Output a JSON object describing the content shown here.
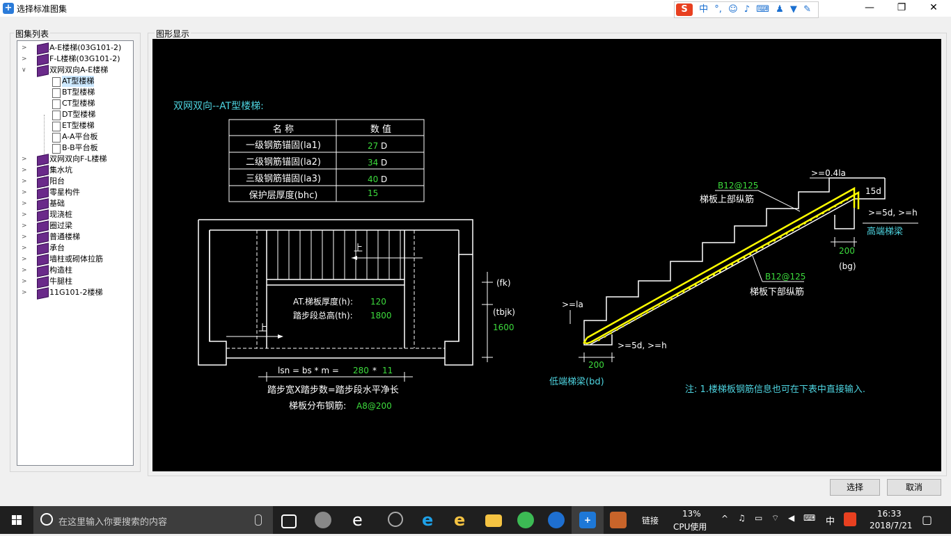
{
  "window": {
    "title": "选择标准图集",
    "minimize": "—",
    "maximize": "❐",
    "close": "✕"
  },
  "ime_toolbar": {
    "logo": "S",
    "mode": "中",
    "punct": "°,",
    "icons": [
      "smiley-icon",
      "mic-icon",
      "keyboard-icon",
      "user-icon",
      "shirt-icon",
      "wrench-icon"
    ]
  },
  "left_panel": {
    "title": "图集列表",
    "tree": [
      {
        "label": "A-E楼梯(03G101-2)",
        "level": 0,
        "expanded": false
      },
      {
        "label": "F-L楼梯(03G101-2)",
        "level": 0,
        "expanded": false
      },
      {
        "label": "双网双向A-E楼梯",
        "level": 0,
        "expanded": true
      },
      {
        "label": "AT型楼梯",
        "level": 1,
        "selected": true
      },
      {
        "label": "BT型楼梯",
        "level": 1
      },
      {
        "label": "CT型楼梯",
        "level": 1
      },
      {
        "label": "DT型楼梯",
        "level": 1
      },
      {
        "label": "ET型楼梯",
        "level": 1
      },
      {
        "label": "A-A平台板",
        "level": 1
      },
      {
        "label": "B-B平台板",
        "level": 1
      },
      {
        "label": "双网双向F-L楼梯",
        "level": 0
      },
      {
        "label": "集水坑",
        "level": 0
      },
      {
        "label": "阳台",
        "level": 0
      },
      {
        "label": "零星构件",
        "level": 0
      },
      {
        "label": "基础",
        "level": 0
      },
      {
        "label": "现浇桩",
        "level": 0
      },
      {
        "label": "圈过梁",
        "level": 0
      },
      {
        "label": "普通楼梯",
        "level": 0
      },
      {
        "label": "承台",
        "level": 0
      },
      {
        "label": "墙柱或砌体拉筋",
        "level": 0
      },
      {
        "label": "构造柱",
        "level": 0
      },
      {
        "label": "牛腿柱",
        "level": 0
      },
      {
        "label": "11G101-2楼梯",
        "level": 0
      }
    ]
  },
  "right_panel": {
    "title": "图形显示"
  },
  "drawing": {
    "heading": "双网双向--AT型楼梯:",
    "table": {
      "headers": [
        "名 称",
        "数 值"
      ],
      "rows": [
        {
          "name": "一级钢筋锚固(la1)",
          "value": "27",
          "unit": "D"
        },
        {
          "name": "二级钢筋锚固(la2)",
          "value": "34",
          "unit": "D"
        },
        {
          "name": "三级钢筋锚固(la3)",
          "value": "40",
          "unit": "D"
        },
        {
          "name": "保护层厚度(bhc)",
          "value": "15",
          "unit": ""
        }
      ]
    },
    "plan": {
      "up1": "上",
      "up2": "上",
      "thickness_label": "AT.梯板厚度(h):",
      "thickness_value": "120",
      "height_label": "踏步段总高(th):",
      "height_value": "1800",
      "fk": "(fk)",
      "tbjk": "(tbjk)",
      "tbjk_value": "1600",
      "lsn_label": "lsn = bs * m =",
      "bs_value": "280",
      "times": "*",
      "m_value": "11",
      "formula_text": "踏步宽X踏步数=踏步段水平净长",
      "dist_label": "梯板分布钢筋:",
      "dist_value": "A8@200"
    },
    "section": {
      "top_bar_code": "B12@125",
      "top_bar_label": "梯板上部纵筋",
      "bottom_bar_code": "B12@125",
      "bottom_bar_label": "梯板下部纵筋",
      "anchor_top": ">=0.4la",
      "d15": "15d",
      "anchor_right": ">=5d, >=h",
      "high_beam": "高端梯梁",
      "bg_value": "200",
      "bg_label": "(bg)",
      "anchor_la": ">=la",
      "anchor_low": ">=5d, >=h",
      "bd_value": "200",
      "low_beam": "低端梯梁(bd)"
    },
    "note": "注: 1.楼梯板钢筋信息也可在下表中直接输入."
  },
  "buttons": {
    "ok": "选择",
    "cancel": "取消"
  },
  "taskbar": {
    "search_placeholder": "在这里输入你要搜索的内容",
    "link": "链接",
    "cpu_percent": "13%",
    "cpu_label": "CPU使用",
    "ime": "中",
    "time": "16:33",
    "date": "2018/7/21",
    "colors": {
      "accent": "#0078d7",
      "ie": "#1ea1e8",
      "green": "#3cba54",
      "folder": "#f5c342"
    }
  }
}
